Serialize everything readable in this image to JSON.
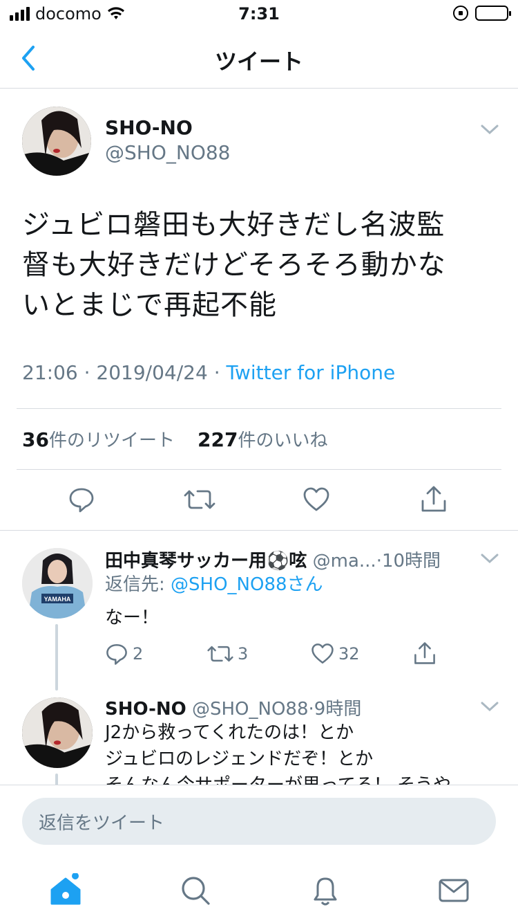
{
  "status_bar": {
    "carrier": "docomo",
    "time": "7:31"
  },
  "nav": {
    "title": "ツイート"
  },
  "tweet": {
    "author_name": "SHO-NO",
    "author_handle": "@SHO_NO88",
    "body_lines": [
      "ジュビロ磐田も大好きだし名波監",
      "督も大好きだけどそろそろ動かな",
      "いとまじで再起不能"
    ],
    "time": "21:06",
    "date": "2019/04/24",
    "separator": "·",
    "source": "Twitter for iPhone",
    "retweets_count": "36",
    "retweets_label": "件のリツイート",
    "likes_count": "227",
    "likes_label": "件のいいね"
  },
  "reply1": {
    "name": "田中真琴サッカー用⚽️呟",
    "handle": "@ma...",
    "dot": "·",
    "age": "10時間",
    "reply_prefix": "返信先:",
    "reply_to": "@SHO_NO88さん",
    "text": "なー！",
    "reply_count": "2",
    "retweet_count": "3",
    "like_count": "32",
    "avatar_jersey_text": "YAMAHA"
  },
  "reply2": {
    "name": "SHO-NO",
    "handle": "@SHO_NO88",
    "dot": "·",
    "age": "9時間",
    "lines": [
      "J2から救ってくれたのは！とか",
      "ジュビロのレジェンドだぞ！とか",
      "そんなん今サポーターが思ってる！ そうや"
    ]
  },
  "composer": {
    "placeholder": "返信をツイート"
  },
  "tabbar": {
    "items": [
      "home-icon",
      "search-icon",
      "notifications-icon",
      "messages-icon"
    ]
  },
  "colors": {
    "accent": "#1da1f2",
    "secondary_text": "#657786",
    "divider": "#d7dbe0"
  }
}
